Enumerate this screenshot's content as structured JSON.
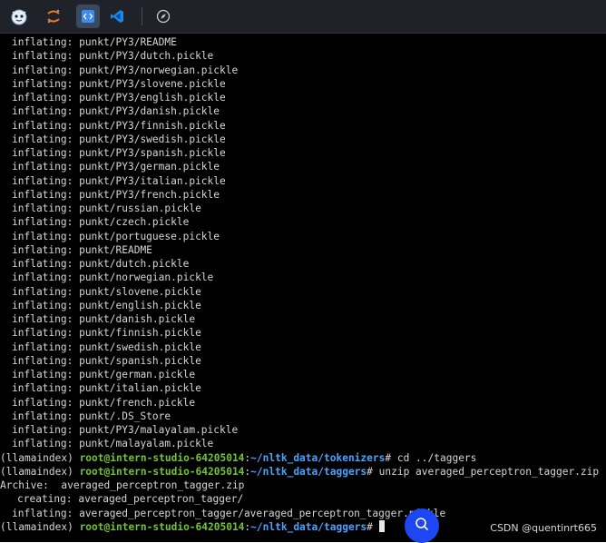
{
  "toolbar": {
    "icons": [
      "mascot-logo-icon",
      "jupyter-icon",
      "code-editor-icon",
      "vscode-icon",
      "compass-icon"
    ]
  },
  "terminal": {
    "output_lines": [
      "inflating: punkt/PY3/README",
      "inflating: punkt/PY3/dutch.pickle",
      "inflating: punkt/PY3/norwegian.pickle",
      "inflating: punkt/PY3/slovene.pickle",
      "inflating: punkt/PY3/english.pickle",
      "inflating: punkt/PY3/danish.pickle",
      "inflating: punkt/PY3/finnish.pickle",
      "inflating: punkt/PY3/swedish.pickle",
      "inflating: punkt/PY3/spanish.pickle",
      "inflating: punkt/PY3/german.pickle",
      "inflating: punkt/PY3/italian.pickle",
      "inflating: punkt/PY3/french.pickle",
      "inflating: punkt/russian.pickle",
      "inflating: punkt/czech.pickle",
      "inflating: punkt/portuguese.pickle",
      "inflating: punkt/README",
      "inflating: punkt/dutch.pickle",
      "inflating: punkt/norwegian.pickle",
      "inflating: punkt/slovene.pickle",
      "inflating: punkt/english.pickle",
      "inflating: punkt/danish.pickle",
      "inflating: punkt/finnish.pickle",
      "inflating: punkt/swedish.pickle",
      "inflating: punkt/spanish.pickle",
      "inflating: punkt/german.pickle",
      "inflating: punkt/italian.pickle",
      "inflating: punkt/french.pickle",
      "inflating: punkt/.DS_Store",
      "inflating: punkt/PY3/malayalam.pickle",
      "inflating: punkt/malayalam.pickle"
    ],
    "prompt1": {
      "env": "(llamaindex) ",
      "user": "root@intern-studio-64205014",
      "sep": ":",
      "path": "~/nltk_data/tokenizers",
      "sym": "# ",
      "cmd": "cd ../taggers"
    },
    "prompt2": {
      "env": "(llamaindex) ",
      "user": "root@intern-studio-64205014",
      "sep": ":",
      "path": "~/nltk_data/taggers",
      "sym": "# ",
      "cmd": "unzip averaged_perceptron_tagger.zip"
    },
    "archive_line": "Archive:  averaged_perceptron_tagger.zip",
    "creating_line": "creating: averaged_perceptron_tagger/",
    "inflating_final_line": "inflating: averaged_perceptron_tagger/averaged_perceptron_tagger.pickle",
    "prompt3": {
      "env": "(llamaindex) ",
      "user": "root@intern-studio-64205014",
      "sep": ":",
      "path": "~/nltk_data/taggers",
      "sym": "# "
    }
  },
  "floating_button_icon": "chat-assistant-icon",
  "watermark": "CSDN @quentinrt665",
  "colors": {
    "terminal_bg": "#000000",
    "prompt_user": "#71c334",
    "prompt_path": "#4aa3ff",
    "fab": "#1c47f2"
  }
}
